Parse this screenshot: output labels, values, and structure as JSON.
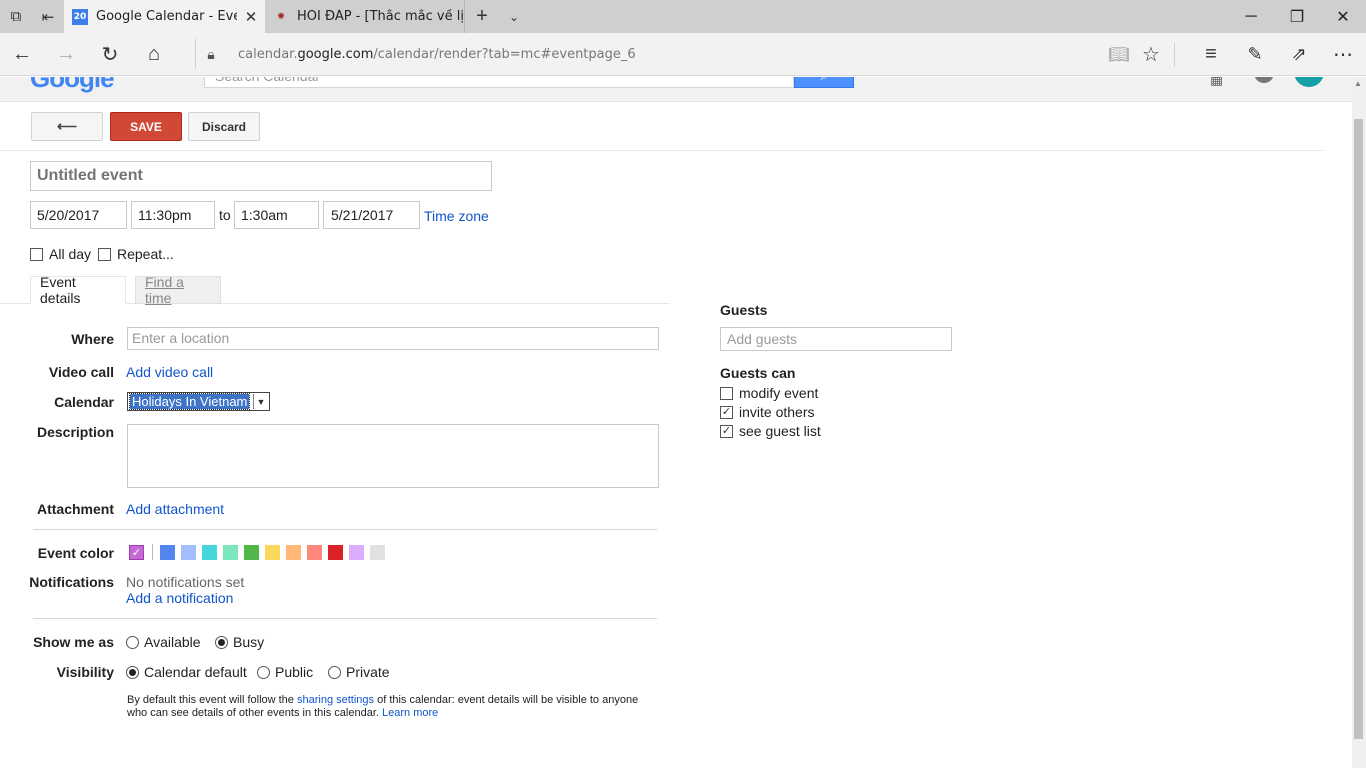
{
  "browser": {
    "tabs": [
      {
        "title": "Google Calendar - Even",
        "favicon": "calendar-icon",
        "favicon_text": "20"
      },
      {
        "title": "HỎI ĐÁP - [Thắc mắc về lịch",
        "favicon": "website-icon"
      }
    ],
    "url_prefix": "calendar.",
    "url_domain": "google.com",
    "url_path": "/calendar/render?tab=mc#eventpage_6"
  },
  "header": {
    "logo": "Google",
    "search_placeholder": "Search Calendar"
  },
  "toolbar": {
    "back_label": "⟵",
    "save_label": "SAVE",
    "discard_label": "Discard"
  },
  "event": {
    "title_placeholder": "Untitled event",
    "start_date": "5/20/2017",
    "start_time": "11:30pm",
    "to_label": "to",
    "end_time": "1:30am",
    "end_date": "5/21/2017",
    "time_zone_label": "Time zone",
    "all_day_label": "All day",
    "repeat_label": "Repeat...",
    "all_day_checked": false,
    "repeat_checked": false
  },
  "detail_tabs": [
    {
      "label": "Event details",
      "active": true
    },
    {
      "label": "Find a time",
      "active": false
    }
  ],
  "details": {
    "where_label": "Where",
    "where_placeholder": "Enter a location",
    "video_label": "Video call",
    "video_link": "Add video call",
    "calendar_label": "Calendar",
    "calendar_value": "Holidays In Vietnam",
    "description_label": "Description",
    "attachment_label": "Attachment",
    "attachment_link": "Add attachment",
    "color_label": "Event color",
    "selected_color": "#c669d6",
    "colors": [
      "#5484ed",
      "#a4bdfc",
      "#46d6db",
      "#7ae7bf",
      "#51b749",
      "#fbd75b",
      "#ffb878",
      "#ff887c",
      "#dc2127",
      "#dbadff",
      "#e1e1e1"
    ],
    "notifications_label": "Notifications",
    "notifications_status": "No notifications set",
    "add_notification_link": "Add a notification",
    "show_me_as_label": "Show me as",
    "show_me_as_options": [
      {
        "label": "Available",
        "selected": false
      },
      {
        "label": "Busy",
        "selected": true
      }
    ],
    "visibility_label": "Visibility",
    "visibility_options": [
      {
        "label": "Calendar default",
        "selected": true
      },
      {
        "label": "Public",
        "selected": false
      },
      {
        "label": "Private",
        "selected": false
      }
    ],
    "visibility_note_1": "By default this event will follow the ",
    "visibility_note_link": "sharing settings",
    "visibility_note_2": " of this calendar: event details will be visible to anyone who can see details of other events in this calendar. ",
    "visibility_learn_more": "Learn more"
  },
  "guests": {
    "heading": "Guests",
    "add_placeholder": "Add guests",
    "can_heading": "Guests can",
    "options": [
      {
        "label": "modify event",
        "checked": false
      },
      {
        "label": "invite others",
        "checked": true
      },
      {
        "label": "see guest list",
        "checked": true
      }
    ]
  }
}
